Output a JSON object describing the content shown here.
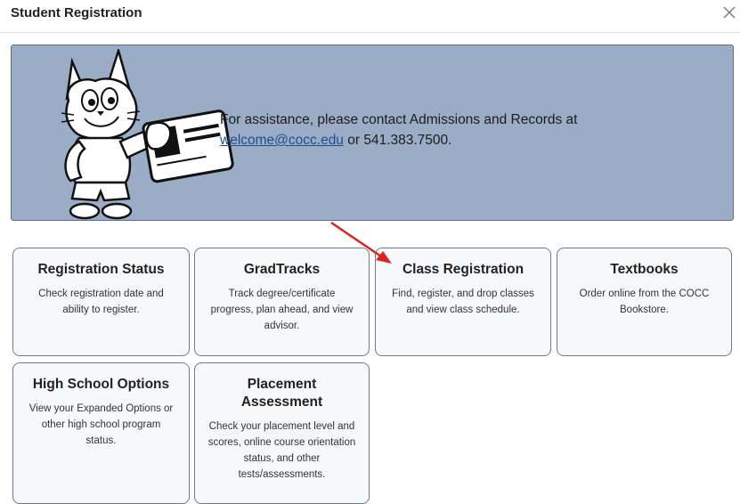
{
  "header": {
    "title": "Student Registration",
    "close_glyph": "×"
  },
  "banner": {
    "text_before": "For assistance, please contact Admissions and Records at",
    "email": "welcome@cocc.edu",
    "text_after": " or 541.383.7500.",
    "mascot_icon": "bobcat-mascot-holding-id-card"
  },
  "cards": [
    {
      "title": "Registration Status",
      "desc": "Check registration date and ability to register."
    },
    {
      "title": "GradTracks",
      "desc": "Track degree/certificate progress, plan ahead, and view advisor."
    },
    {
      "title": "Class Registration",
      "desc": "Find, register, and drop classes and view class schedule."
    },
    {
      "title": "Textbooks",
      "desc": "Order online from the COCC Bookstore."
    },
    {
      "title": "High School Options",
      "desc": "View your Expanded Options or other high school program status."
    },
    {
      "title": "Placement Assessment",
      "desc": "Check your placement level and scores, online course orientation status, and other tests/assessments."
    }
  ],
  "colors": {
    "banner_bg": "#9aacc6",
    "annotation_arrow": "#e02020"
  }
}
